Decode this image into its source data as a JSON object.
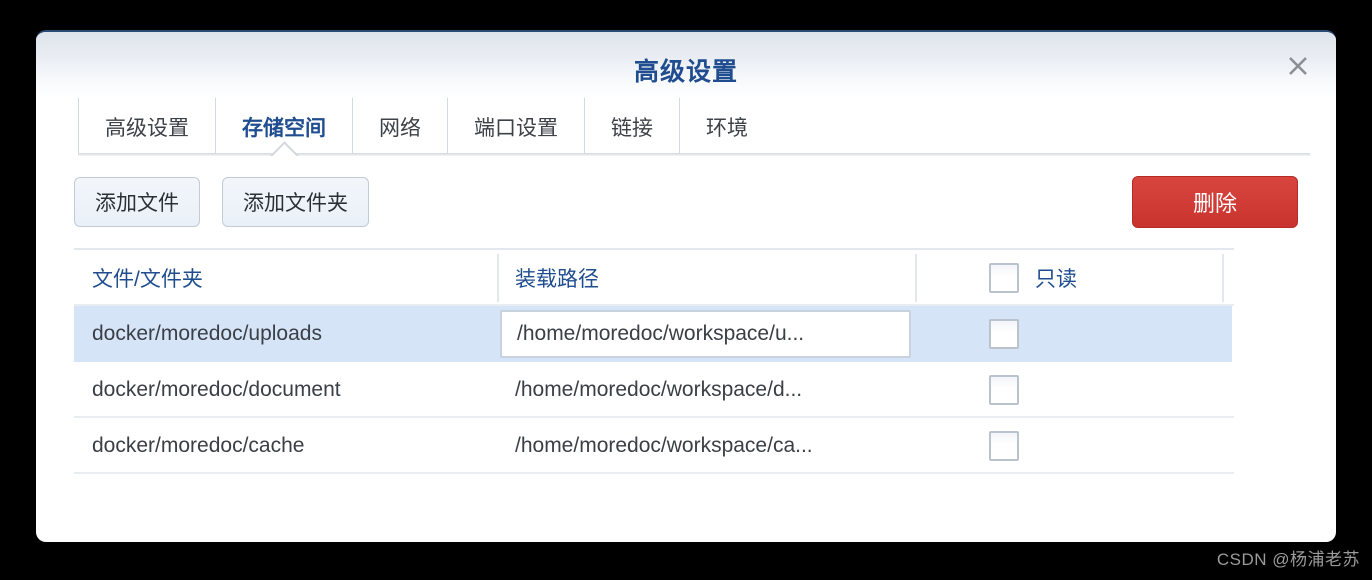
{
  "dialog": {
    "title": "高级设置",
    "close_icon": "close-icon"
  },
  "tabs": [
    {
      "label": "高级设置",
      "active": false
    },
    {
      "label": "存储空间",
      "active": true
    },
    {
      "label": "网络",
      "active": false
    },
    {
      "label": "端口设置",
      "active": false
    },
    {
      "label": "链接",
      "active": false
    },
    {
      "label": "环境",
      "active": false
    }
  ],
  "toolbar": {
    "add_file_label": "添加文件",
    "add_folder_label": "添加文件夹",
    "delete_label": "删除",
    "delete_color": "#c9332d"
  },
  "table": {
    "headers": {
      "name": "文件/文件夹",
      "path": "装载路径",
      "readonly": "只读",
      "extra": ""
    },
    "header_color": "#1f4d8f",
    "select_all_checked": false,
    "rows": [
      {
        "name": "docker/moredoc/uploads",
        "path": "/home/moredoc/workspace/u...",
        "readonly": false,
        "selected": true,
        "editing": true
      },
      {
        "name": "docker/moredoc/document",
        "path": "/home/moredoc/workspace/d...",
        "readonly": false,
        "selected": false,
        "editing": false
      },
      {
        "name": "docker/moredoc/cache",
        "path": "/home/moredoc/workspace/ca...",
        "readonly": false,
        "selected": false,
        "editing": false
      }
    ]
  },
  "watermark": "CSDN @杨浦老苏"
}
